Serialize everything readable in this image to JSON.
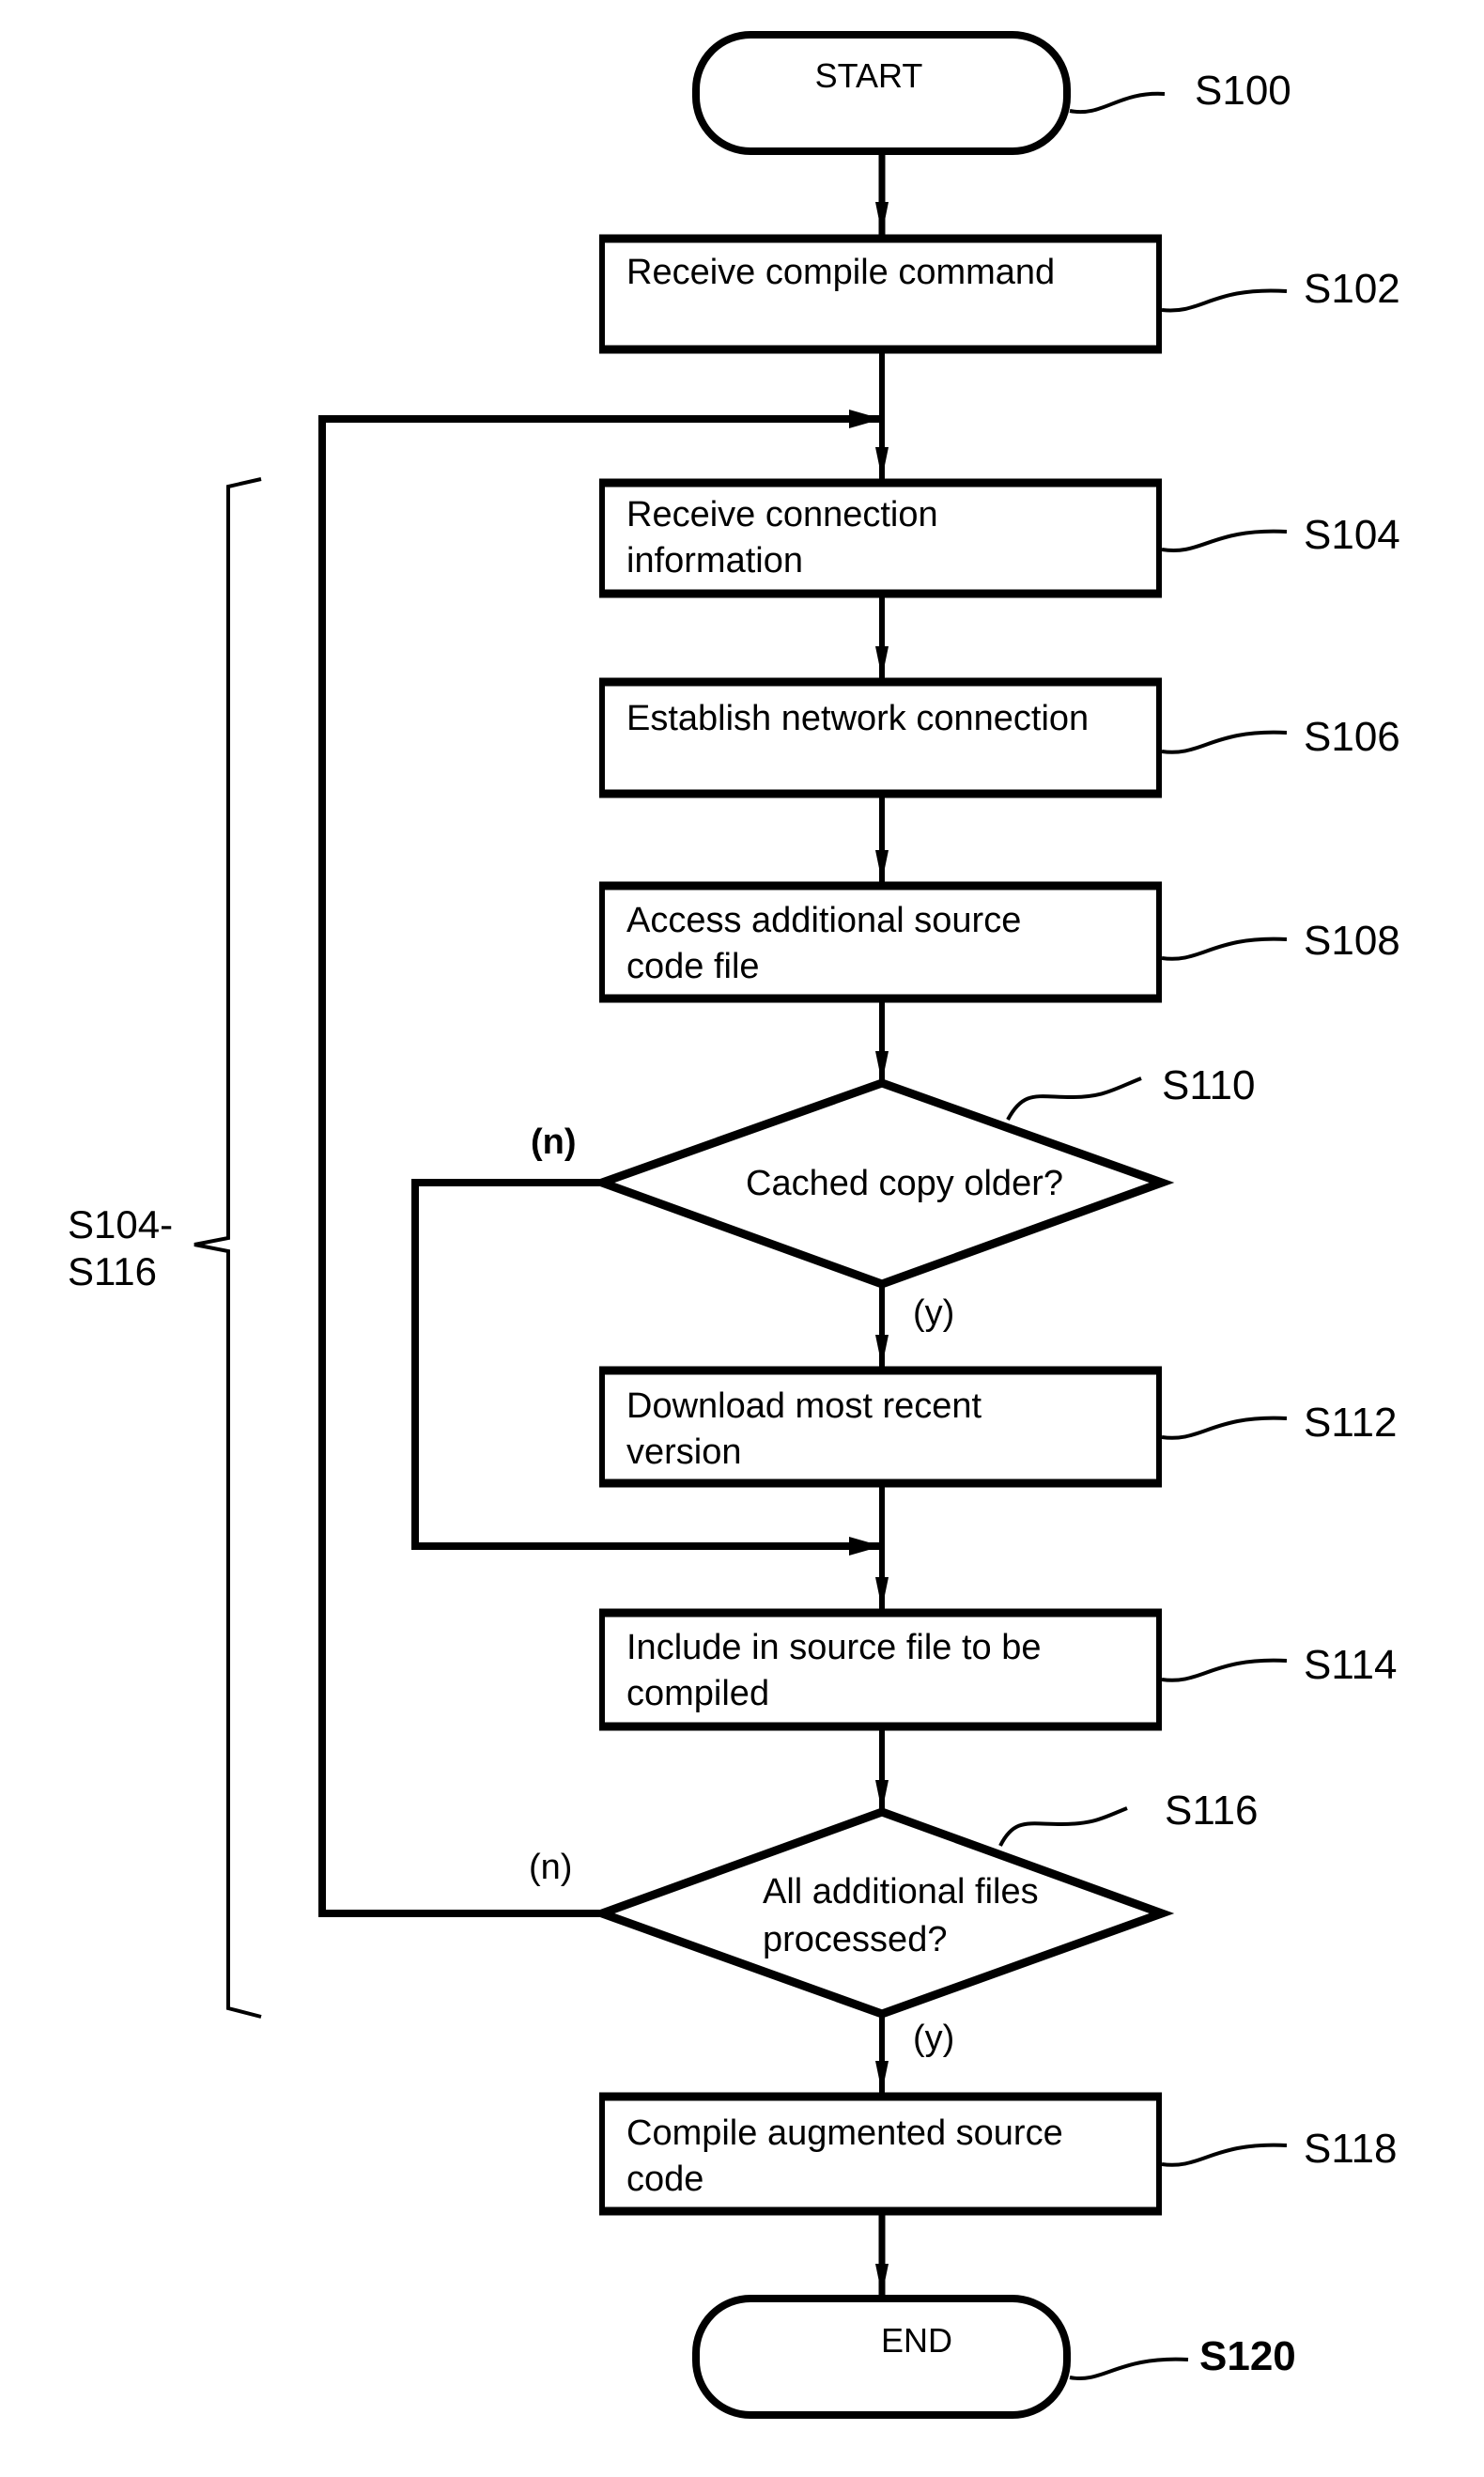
{
  "diagram": {
    "type": "flowchart",
    "steps": [
      {
        "id": "S100",
        "kind": "terminal",
        "lines": [
          "START"
        ]
      },
      {
        "id": "S102",
        "kind": "process",
        "lines": [
          "Receive compile command"
        ]
      },
      {
        "id": "S104",
        "kind": "process",
        "lines": [
          "Receive connection",
          "information"
        ]
      },
      {
        "id": "S106",
        "kind": "process",
        "lines": [
          "Establish network connection"
        ]
      },
      {
        "id": "S108",
        "kind": "process",
        "lines": [
          "Access additional source",
          "code file"
        ]
      },
      {
        "id": "S110",
        "kind": "decision",
        "lines": [
          "Cached copy older?"
        ],
        "yes_label": "(y)",
        "no_label": "(n)"
      },
      {
        "id": "S112",
        "kind": "process",
        "lines": [
          "Download most recent",
          "version"
        ]
      },
      {
        "id": "S114",
        "kind": "process",
        "lines": [
          "Include in source file to be",
          "compiled"
        ]
      },
      {
        "id": "S116",
        "kind": "decision",
        "lines": [
          "All additional files",
          "processed?"
        ],
        "yes_label": "(y)",
        "no_label": "(n)"
      },
      {
        "id": "S118",
        "kind": "process",
        "lines": [
          "Compile augmented source",
          "code"
        ]
      },
      {
        "id": "S120",
        "kind": "terminal",
        "lines": [
          "END"
        ]
      }
    ],
    "edges": [
      {
        "from": "S100",
        "to": "S102"
      },
      {
        "from": "S102",
        "to": "S104"
      },
      {
        "from": "S104",
        "to": "S106"
      },
      {
        "from": "S106",
        "to": "S108"
      },
      {
        "from": "S108",
        "to": "S110"
      },
      {
        "from": "S110",
        "to": "S112",
        "label": "(y)"
      },
      {
        "from": "S110",
        "to": "S114",
        "label": "(n)"
      },
      {
        "from": "S112",
        "to": "S114"
      },
      {
        "from": "S114",
        "to": "S116"
      },
      {
        "from": "S116",
        "to": "S118",
        "label": "(y)"
      },
      {
        "from": "S116",
        "to": "S104",
        "label": "(n)"
      },
      {
        "from": "S118",
        "to": "S120"
      }
    ],
    "brace": {
      "lines": [
        "S104-",
        "S116"
      ]
    },
    "refs": {
      "S100": "S100",
      "S102": "S102",
      "S104": "S104",
      "S106": "S106",
      "S108": "S108",
      "S110": "S110",
      "S112": "S112",
      "S114": "S114",
      "S116": "S116",
      "S118": "S118",
      "S120": "S120"
    }
  }
}
